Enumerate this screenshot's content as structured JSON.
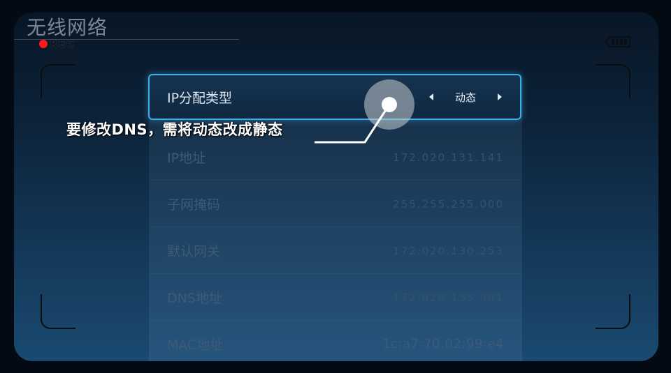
{
  "header": {
    "title": "无线网络",
    "rec_label": "REC"
  },
  "menu": {
    "selected": {
      "label": "IP分配类型",
      "value": "动态"
    },
    "rows": [
      {
        "label": "IP地址",
        "value": "172.020.131.141"
      },
      {
        "label": "子网掩码",
        "value": "255.255.255.000"
      },
      {
        "label": "默认网关",
        "value": "172.020.130.253"
      },
      {
        "label": "DNS地址",
        "value": "172.020.135.001"
      },
      {
        "label": "MAC地址",
        "value": "1c:a7:70:02:99:e4"
      }
    ]
  },
  "annotation": {
    "text": "要修改DNS，需将动态改成静态"
  },
  "colors": {
    "accent": "#3eaee6",
    "rec_dot": "#ff1818"
  },
  "icons": {
    "battery": "battery-icon",
    "left": "arrow-left-icon",
    "right": "arrow-right-icon"
  }
}
